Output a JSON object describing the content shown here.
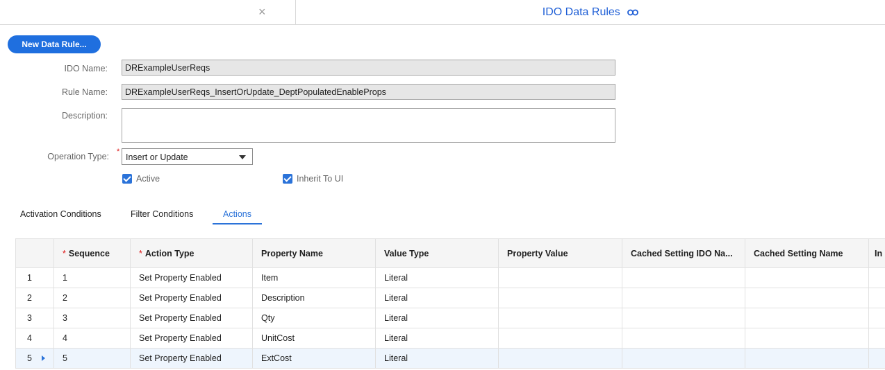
{
  "header": {
    "close_glyph": "×",
    "title": "IDO Data Rules"
  },
  "toolbar": {
    "new_rule_label": "New Data Rule..."
  },
  "form": {
    "ido_name_label": "IDO Name:",
    "ido_name_value": "DRExampleUserReqs",
    "rule_name_label": "Rule Name:",
    "rule_name_value": "DRExampleUserReqs_InsertOrUpdate_DeptPopulatedEnableProps",
    "description_label": "Description:",
    "description_value": "",
    "operation_type_label": "Operation Type:",
    "required_marker": "*",
    "operation_type_value": "Insert or Update",
    "active_label": "Active",
    "active_checked": true,
    "inherit_label": "Inherit To UI",
    "inherit_checked": true
  },
  "tabs": [
    {
      "label": "Activation Conditions",
      "active": false
    },
    {
      "label": "Filter Conditions",
      "active": false
    },
    {
      "label": "Actions",
      "active": true
    }
  ],
  "grid": {
    "columns": [
      {
        "label": "",
        "required": false
      },
      {
        "label": "Sequence",
        "required": true
      },
      {
        "label": "Action Type",
        "required": true
      },
      {
        "label": "Property Name",
        "required": false
      },
      {
        "label": "Value Type",
        "required": false
      },
      {
        "label": "Property Value",
        "required": false
      },
      {
        "label": "Cached Setting IDO Na...",
        "required": false
      },
      {
        "label": "Cached Setting Name",
        "required": false
      },
      {
        "label": "In",
        "required": false
      }
    ],
    "rows": [
      {
        "num": "1",
        "sequence": "1",
        "action_type": "Set Property Enabled",
        "property_name": "Item",
        "value_type": "Literal",
        "property_value": "",
        "cached_ido": "",
        "cached_name": "",
        "extra": "",
        "selected": false
      },
      {
        "num": "2",
        "sequence": "2",
        "action_type": "Set Property Enabled",
        "property_name": "Description",
        "value_type": "Literal",
        "property_value": "",
        "cached_ido": "",
        "cached_name": "",
        "extra": "",
        "selected": false
      },
      {
        "num": "3",
        "sequence": "3",
        "action_type": "Set Property Enabled",
        "property_name": "Qty",
        "value_type": "Literal",
        "property_value": "",
        "cached_ido": "",
        "cached_name": "",
        "extra": "",
        "selected": false
      },
      {
        "num": "4",
        "sequence": "4",
        "action_type": "Set Property Enabled",
        "property_name": "UnitCost",
        "value_type": "Literal",
        "property_value": "",
        "cached_ido": "",
        "cached_name": "",
        "extra": "",
        "selected": false
      },
      {
        "num": "5",
        "sequence": "5",
        "action_type": "Set Property Enabled",
        "property_name": "ExtCost",
        "value_type": "Literal",
        "property_value": "",
        "cached_ido": "",
        "cached_name": "",
        "extra": "",
        "selected": true
      }
    ]
  },
  "colors": {
    "accent": "#2b73d9",
    "button": "#1f6fdf",
    "required": "#dd1111"
  },
  "icons": [
    "close-icon",
    "link-icon",
    "dropdown-caret-icon",
    "checkbox-checked-icon",
    "row-indicator-icon"
  ]
}
